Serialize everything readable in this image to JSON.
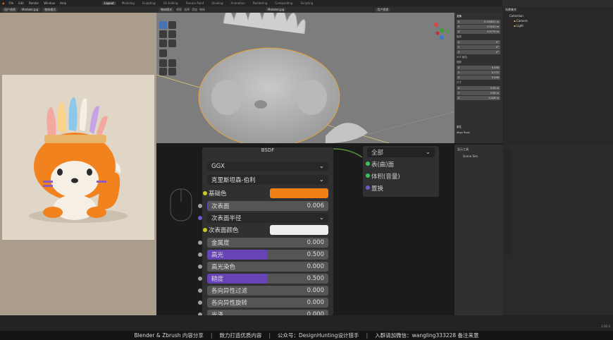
{
  "topbar": {
    "menus": [
      "File",
      "Edit",
      "Render",
      "Window",
      "Help"
    ],
    "workspaces": [
      "Layout",
      "Modeling",
      "Sculpting",
      "UV Editing",
      "Texture Paint",
      "Shading",
      "Animation",
      "Rendering",
      "Compositing",
      "Scripting"
    ],
    "active_workspace": "Layout",
    "scene": "Scene",
    "view_layer": "View Layer"
  },
  "image_editor_header": {
    "view": "用户透视",
    "name": "Modeler.jpg",
    "object_mode": "物体模式"
  },
  "viewport_header": {
    "mode": "物体模式",
    "view": "视图",
    "select": "选择",
    "add": "添加",
    "object": "物体",
    "overlay_label": "Modeler.jpg",
    "shading": "用户透视"
  },
  "viewport": {
    "accent": "#e8a33b"
  },
  "npanel": {
    "sections": [
      {
        "title": "变换",
        "rows": [
          [
            "X",
            "0.126021 m"
          ],
          [
            "Y",
            "0.0101 m"
          ],
          [
            "Z",
            "0.9775 m"
          ]
        ]
      },
      {
        "title": "旋转",
        "rows": [
          [
            "X",
            "0°"
          ],
          [
            "Y",
            "0°"
          ],
          [
            "Z",
            "0°"
          ]
        ]
      },
      {
        "title": "XYZ 欧拉",
        "rows": []
      },
      {
        "title": "缩放",
        "rows": [
          [
            "X",
            "0.456"
          ],
          [
            "Y",
            "0.272"
          ],
          [
            "Z",
            "0.456"
          ]
        ]
      },
      {
        "title": "尺寸",
        "rows": [
          [
            "X",
            "0.39 m"
          ],
          [
            "Y",
            "0.08 m"
          ],
          [
            "Z",
            "0.426 m"
          ]
        ]
      }
    ],
    "footer1": "属性",
    "footer2": "Align Tools"
  },
  "outliner": {
    "title": "场景集合",
    "items": [
      "Collection",
      "Camera",
      "Light"
    ]
  },
  "node_editor": {
    "bsdf_label": "BSDF",
    "distribution": "GGX",
    "subsurface_method": "克里斯坦森-伯利",
    "base_color_label": "基础色",
    "base_color": "#f08116",
    "rows": [
      {
        "label": "次表面",
        "value": "0.006",
        "fill": 0.006
      },
      {
        "label": "次表面半径",
        "value": ""
      },
      {
        "label": "次表面颜色",
        "value": ""
      },
      {
        "label": "金属度",
        "value": "0.000",
        "fill": 0
      },
      {
        "label": "高光",
        "value": "0.500",
        "fill": 0.5
      },
      {
        "label": "高光染色",
        "value": "0.000",
        "fill": 0
      },
      {
        "label": "糙度",
        "value": "0.500",
        "fill": 0.5
      },
      {
        "label": "各向异性过滤",
        "value": "0.000",
        "fill": 0
      },
      {
        "label": "各向异性旋转",
        "value": "0.000",
        "fill": 0
      },
      {
        "label": "光泽",
        "value": "0.000",
        "fill": 0
      }
    ],
    "subsurface_color": "#eeeeee",
    "accent_purple": "#6644b5",
    "output_select": "全部",
    "outputs": [
      "表(曲)面",
      "体积(音量)",
      "置换"
    ],
    "header_slot": "Slot 1",
    "header_mat": "材质"
  },
  "properties_panel": {
    "title": "显示工具",
    "item": "Scene Sim"
  },
  "banner": {
    "items": [
      "Blender & Zbrush 内容分享",
      "致力打造优质内容",
      "公众号：DesignHunting设计猎手",
      "入群请加微信：wangling333228 备注来意"
    ]
  },
  "status": {
    "version": "2.92.0"
  }
}
